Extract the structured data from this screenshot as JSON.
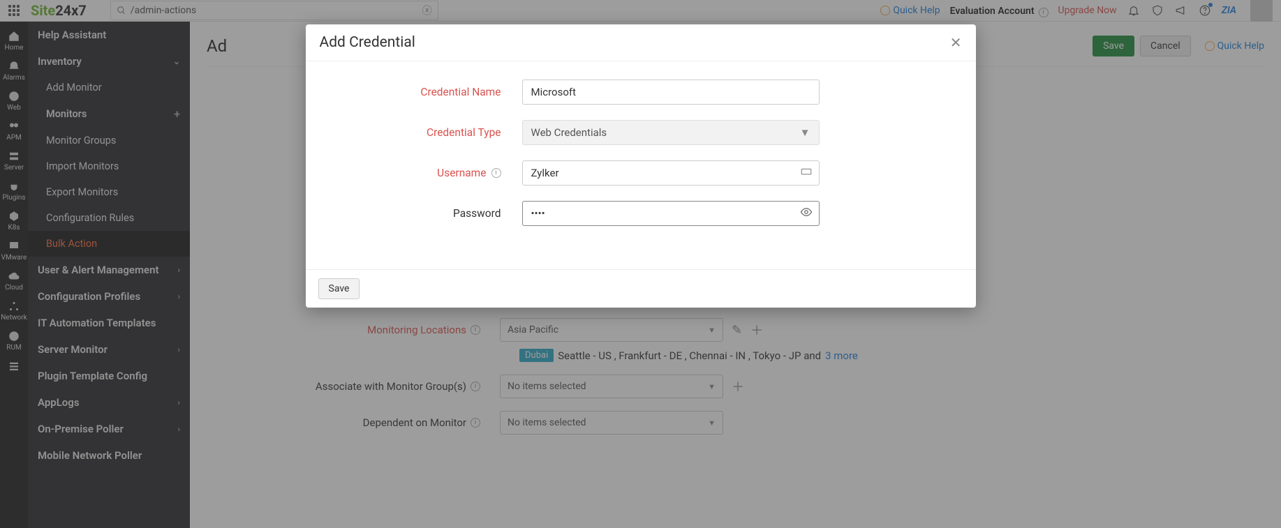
{
  "logo": {
    "part1": "Site",
    "part2": "24x7"
  },
  "search": {
    "value": "/admin-actions"
  },
  "header": {
    "quickhelp": "Quick Help",
    "eval": "Evaluation Account",
    "upgrade": "Upgrade Now",
    "zia": "ZIA"
  },
  "rail": [
    {
      "label": "Home"
    },
    {
      "label": "Alarms"
    },
    {
      "label": "Web"
    },
    {
      "label": "APM"
    },
    {
      "label": "Server"
    },
    {
      "label": "Plugins"
    },
    {
      "label": "K8s"
    },
    {
      "label": "VMware"
    },
    {
      "label": "Cloud"
    },
    {
      "label": "Network"
    },
    {
      "label": "RUM"
    },
    {
      "label": ""
    }
  ],
  "sidemenu": {
    "help": "Help Assistant",
    "inventory": "Inventory",
    "inventory_items": [
      "Add Monitor",
      "Monitors",
      "Monitor Groups",
      "Import Monitors",
      "Export Monitors",
      "Configuration Rules",
      "Bulk Action"
    ],
    "rest": [
      "User & Alert Management",
      "Configuration Profiles",
      "IT Automation Templates",
      "Server Monitor",
      "Plugin Template Config",
      "AppLogs",
      "On-Premise Poller",
      "Mobile Network Poller"
    ]
  },
  "main": {
    "title_prefix": "Ad",
    "save": "Save",
    "cancel": "Cancel",
    "quickhelp": "Quick Help",
    "monloc_label": "Monitoring Locations",
    "monloc_value": "Asia Pacific",
    "chip": "Dubai",
    "locs_text": "Seattle - US , Frankfurt - DE , Chennai - IN , Tokyo - JP and ",
    "more": "3 more",
    "assoc_label": "Associate with Monitor Group(s)",
    "dep_label": "Dependent on Monitor",
    "noitems": "No items selected"
  },
  "modal": {
    "title": "Add Credential",
    "credname_label": "Credential Name",
    "credname_value": "Microsoft",
    "credtype_label": "Credential Type",
    "credtype_value": "Web Credentials",
    "username_label": "Username",
    "username_value": "Zylker",
    "password_label": "Password",
    "password_value": "••••",
    "save": "Save"
  }
}
